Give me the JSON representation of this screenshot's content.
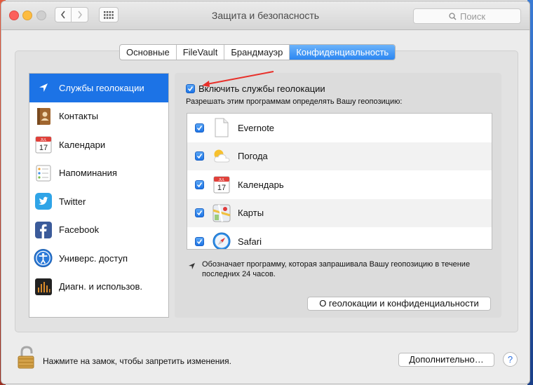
{
  "window": {
    "title": "Защита и безопасность"
  },
  "search": {
    "placeholder": "Поиск"
  },
  "tabs": [
    {
      "label": "Основные"
    },
    {
      "label": "FileVault"
    },
    {
      "label": "Брандмауэр"
    },
    {
      "label": "Конфиденциальность",
      "active": true
    }
  ],
  "sidebar": {
    "items": [
      {
        "label": "Службы геолокации",
        "icon": "location-arrow-icon",
        "active": true
      },
      {
        "label": "Контакты",
        "icon": "contacts-book-icon"
      },
      {
        "label": "Календари",
        "icon": "calendar-icon"
      },
      {
        "label": "Напоминания",
        "icon": "reminders-icon"
      },
      {
        "label": "Twitter",
        "icon": "twitter-icon"
      },
      {
        "label": "Facebook",
        "icon": "facebook-icon"
      },
      {
        "label": "Универс. доступ",
        "icon": "accessibility-icon"
      },
      {
        "label": "Диагн. и использов.",
        "icon": "diagnostics-icon"
      }
    ]
  },
  "main": {
    "enable_label": "Включить службы геолокации",
    "enable_checked": true,
    "allow_label": "Разрешать этим программам определять Вашу геопозицию:",
    "apps": [
      {
        "name": "Evernote",
        "checked": true,
        "icon": "document-icon"
      },
      {
        "name": "Погода",
        "checked": true,
        "icon": "weather-icon"
      },
      {
        "name": "Календарь",
        "checked": true,
        "icon": "calendar-icon"
      },
      {
        "name": "Карты",
        "checked": true,
        "icon": "maps-icon"
      },
      {
        "name": "Safari",
        "checked": true,
        "icon": "safari-compass-icon"
      }
    ],
    "note": "Обозначает программу, которая запрашивала Вашу геопозицию в течение последних 24 часов.",
    "about_button": "О геолокации и конфиденциальности",
    "calendar_month": "JUL",
    "calendar_day": "17"
  },
  "footer": {
    "lock_text": "Нажмите на замок, чтобы запретить изменения.",
    "advanced_button": "Дополнительно…",
    "help_label": "?"
  },
  "colors": {
    "accent": "#1c73e6",
    "annotation_arrow": "#e8302a"
  }
}
